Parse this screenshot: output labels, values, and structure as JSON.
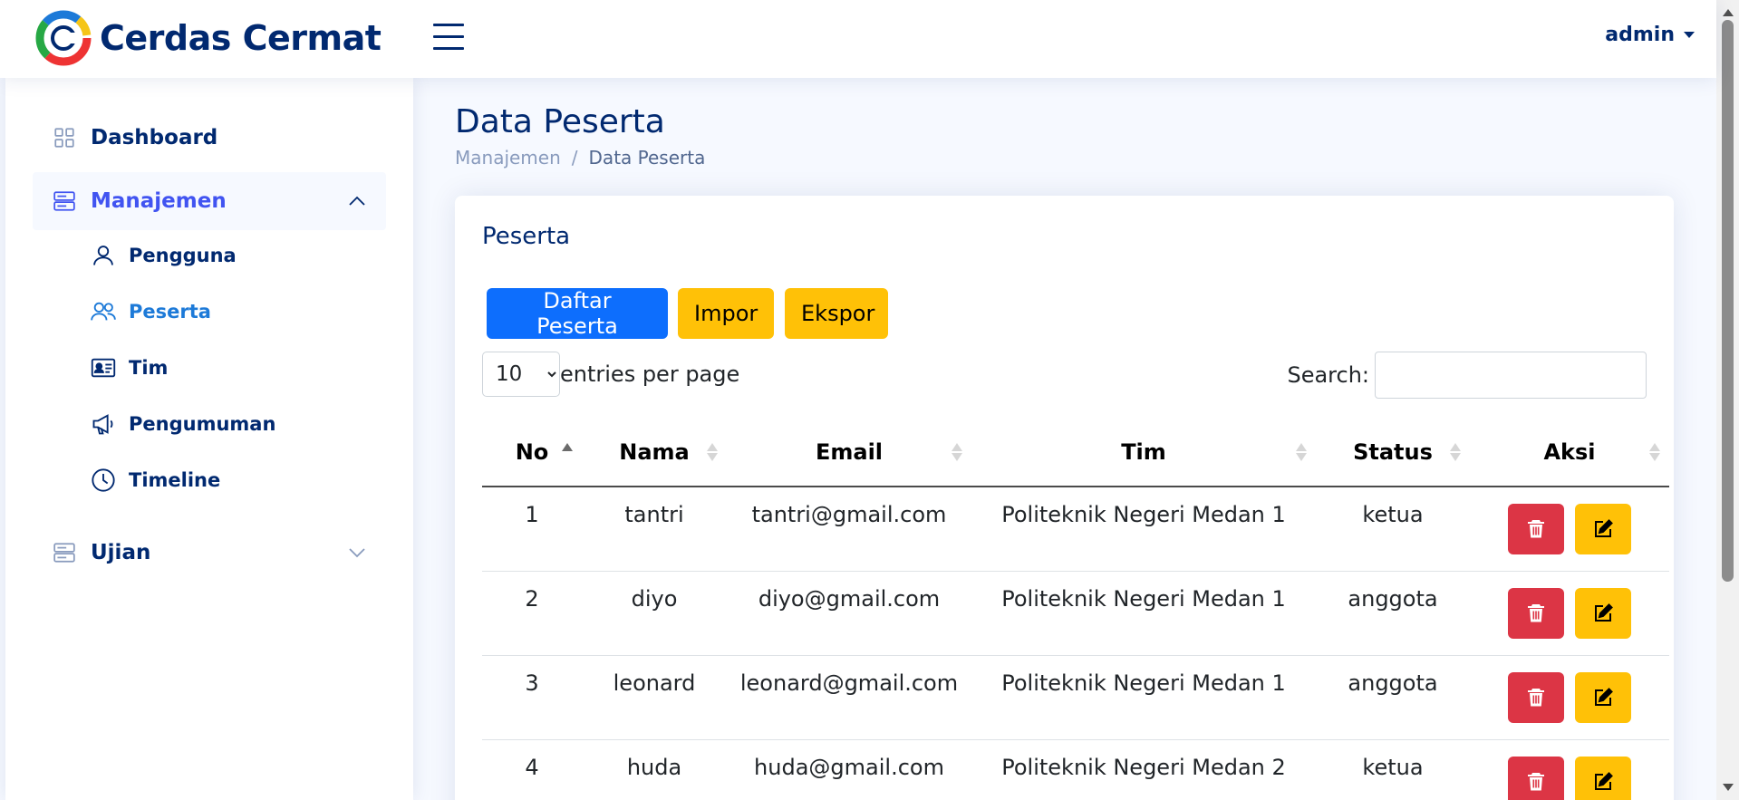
{
  "header": {
    "brand": "Cerdas Cermat",
    "user": "admin"
  },
  "sidebar": {
    "dashboard": "Dashboard",
    "manajemen": "Manajemen",
    "sub": {
      "pengguna": "Pengguna",
      "peserta": "Peserta",
      "tim": "Tim",
      "pengumuman": "Pengumuman",
      "timeline": "Timeline"
    },
    "ujian": "Ujian"
  },
  "page": {
    "title": "Data Peserta",
    "breadcrumb": [
      "Manajemen",
      "/",
      "Data Peserta"
    ]
  },
  "card": {
    "title": "Peserta",
    "buttons": {
      "daftar": "Daftar Peserta",
      "impor": "Impor",
      "ekspor": "Ekspor"
    },
    "entries": {
      "value": "10",
      "label": "entries per page"
    },
    "search_label": "Search:"
  },
  "table": {
    "headers": [
      "No",
      "Nama",
      "Email",
      "Tim",
      "Status",
      "Aksi"
    ],
    "rows": [
      [
        "1",
        "tantri",
        "tantri@gmail.com",
        "Politeknik Negeri Medan 1",
        "ketua"
      ],
      [
        "2",
        "diyo",
        "diyo@gmail.com",
        "Politeknik Negeri Medan 1",
        "anggota"
      ],
      [
        "3",
        "leonard",
        "leonard@gmail.com",
        "Politeknik Negeri Medan 1",
        "anggota"
      ],
      [
        "4",
        "huda",
        "huda@gmail.com",
        "Politeknik Negeri Medan 2",
        "ketua"
      ]
    ]
  },
  "colors": {
    "primary": "#0d6efd",
    "warning": "#ffc107",
    "danger": "#dc3545",
    "navy": "#012970"
  },
  "icons": [
    "menu-icon",
    "grid-icon",
    "server-icon",
    "person-icon",
    "people-icon",
    "id-card-icon",
    "megaphone-icon",
    "clock-icon",
    "trash-icon",
    "pencil-square-icon"
  ]
}
